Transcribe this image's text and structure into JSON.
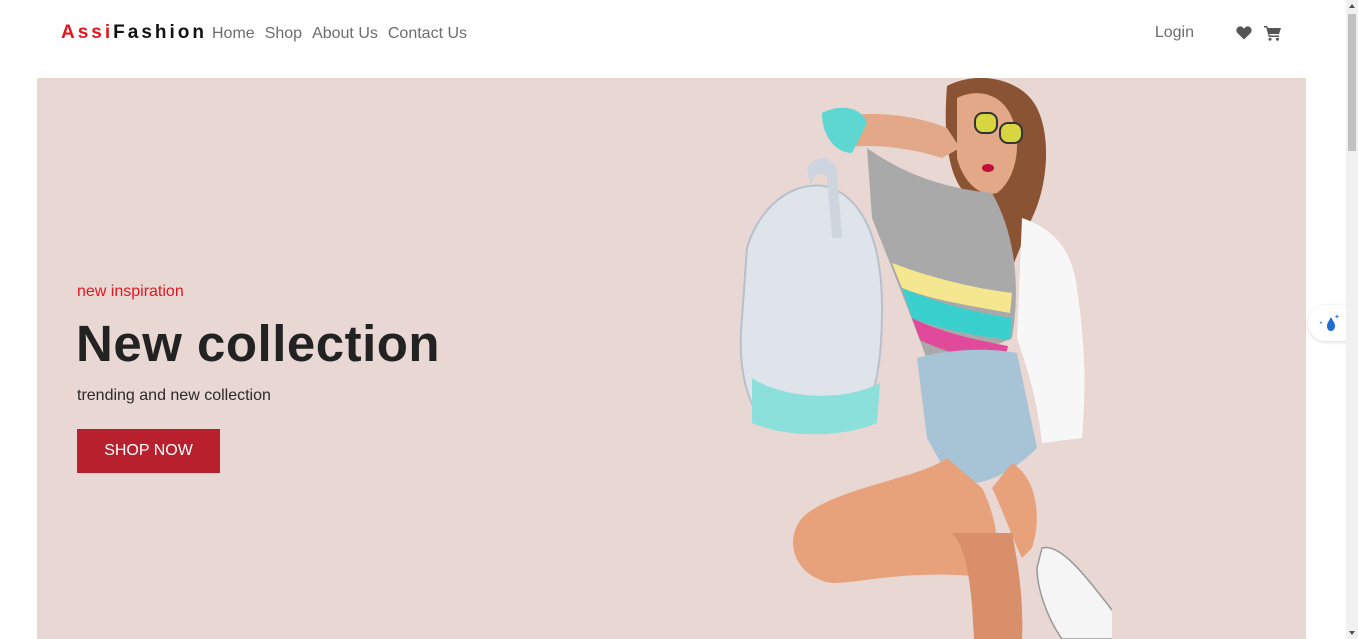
{
  "navbar": {
    "brand_accent": "Assi",
    "brand_rest": "Fashion",
    "links": [
      "Home",
      "Shop",
      "About Us",
      "Contact Us"
    ],
    "login_label": "Login",
    "icons": [
      "heart-icon",
      "cart-icon"
    ]
  },
  "hero": {
    "eyebrow": "new inspiration",
    "title": "New collection",
    "subtitle": "trending and new collection",
    "cta_label": "SHOP NOW",
    "background_color": "#e8d7d3",
    "accent_color": "#e4161f",
    "button_color": "#b8202e"
  },
  "widget": {
    "icon": "water-drop-sparkle-icon"
  }
}
